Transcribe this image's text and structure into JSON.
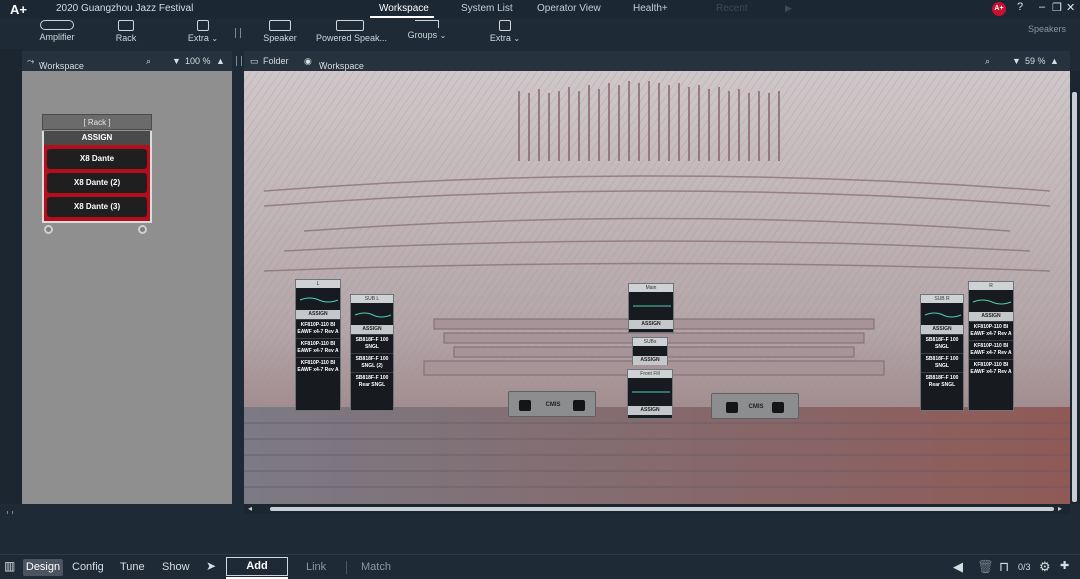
{
  "app": {
    "logo": "A+",
    "project_title": "2020 Guangzhou Jazz Festival",
    "user_badge": "A+",
    "accent_color": "#c8102e"
  },
  "top_tabs": [
    {
      "label": "Workspace",
      "active": true
    },
    {
      "label": "System List"
    },
    {
      "label": "Operator View"
    },
    {
      "label": "Health+"
    },
    {
      "label": "Recent",
      "disabled": true
    }
  ],
  "window_controls": {
    "help": "?",
    "minimize": "–",
    "restore": "❐",
    "close": "✕"
  },
  "toolbar_left": [
    {
      "label": "Amplifier",
      "icon": "amplifier-icon"
    },
    {
      "label": "Rack",
      "icon": "rack-icon"
    },
    {
      "label": "Extra",
      "icon": "image-icon",
      "caret": "⌄"
    }
  ],
  "toolbar_right": [
    {
      "label": "Speaker",
      "icon": "speaker-icon"
    },
    {
      "label": "Powered Speak...",
      "icon": "powered-speaker-icon"
    },
    {
      "label": "Groups",
      "icon": "groups-icon",
      "caret": "⌄"
    },
    {
      "label": "Extra",
      "icon": "image-icon",
      "caret": "⌄"
    }
  ],
  "toolbar_right_label": "Speakers",
  "left_panel": {
    "workspace_label": "Workspace",
    "zoom": "100 %"
  },
  "right_panel": {
    "folder_label": "Folder",
    "workspace_label": "Workspace",
    "zoom": "59 %"
  },
  "rack": {
    "label": "[ Rack ]",
    "assign": "ASSIGN",
    "amplifiers": [
      "X8 Dante",
      "X8 Dante (2)",
      "X8 Dante (3)"
    ],
    "color": "#b40d1c"
  },
  "stage_devices": {
    "L": {
      "header": "L",
      "assign": "ASSIGN",
      "cabinets": [
        "KF810P-110 BI EAWF x4-7 Rev A",
        "KF810P-110 BI EAWF x4-7 Rev A",
        "KF810P-110 BI EAWF x4-7 Rev A"
      ]
    },
    "SUB_L": {
      "header": "SUB L",
      "assign": "ASSIGN",
      "cabinets": [
        "SB818F-F 100 SNGL",
        "SB818F-F 100 SNGL (2)",
        "SB818F-F 100 Rear SNGL"
      ]
    },
    "Main": {
      "header": "Main",
      "assign": "ASSIGN"
    },
    "Subs": {
      "header": "SUBs",
      "assign": "ASSIGN"
    },
    "FrontFill": {
      "header": "Front Fill",
      "assign": "ASSIGN"
    },
    "SUB_R": {
      "header": "SUB R",
      "assign": "ASSIGN",
      "cabinets": [
        "SB818F-F 100 SNGL",
        "SB818F-F 100 SNGL",
        "SB818F-F 100 Rear SNGL"
      ]
    },
    "R": {
      "header": "R",
      "assign": "ASSIGN",
      "cabinets": [
        "KF810P-110 BI EAWF x4-7 Rev A",
        "KF810P-110 BI EAWF x4-7 Rev A",
        "KF810P-110 BI EAWF x4-7 Rev A"
      ]
    },
    "CMIS_1": {
      "label": "CMIS"
    },
    "CMIS_2": {
      "label": "CMIS"
    }
  },
  "footer": {
    "modes": [
      "Design",
      "Config",
      "Tune",
      "Show"
    ],
    "active_mode": "Design",
    "actions": [
      "Add",
      "Link",
      "Match"
    ],
    "active_action": "Add",
    "page_counter": "0/3"
  }
}
